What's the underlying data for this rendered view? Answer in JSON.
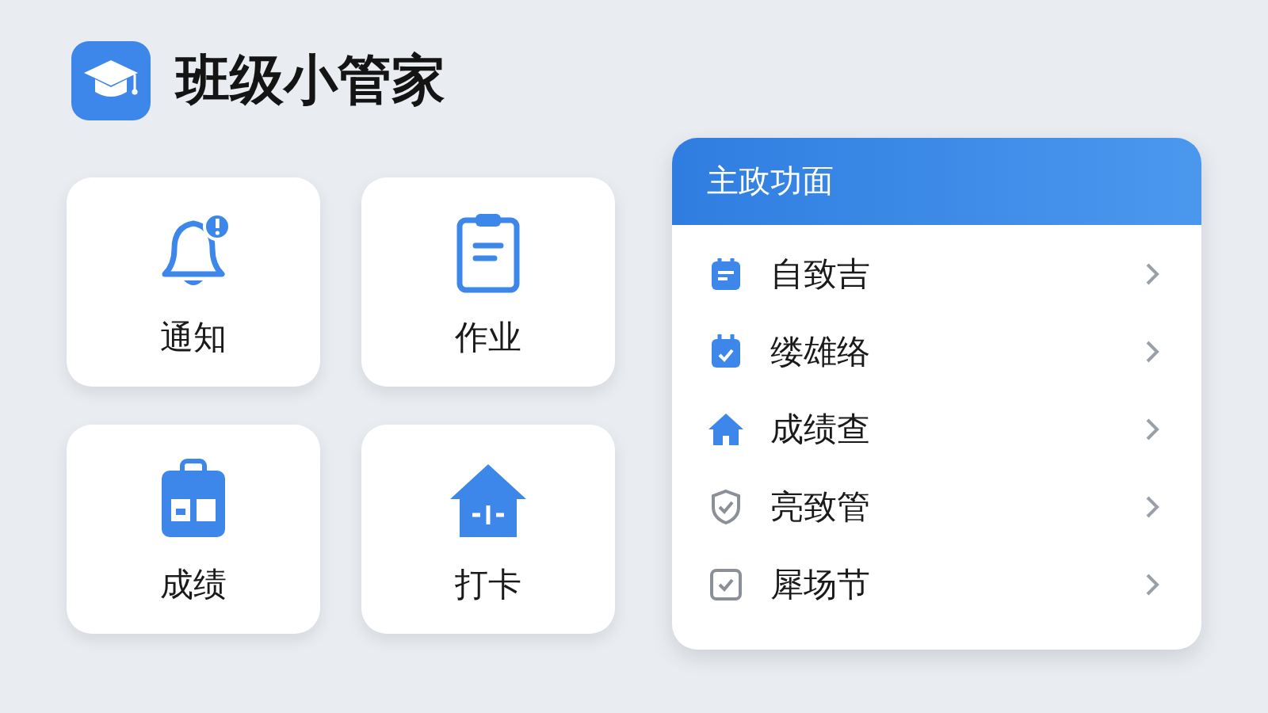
{
  "app": {
    "title": "班级小管家"
  },
  "tiles": [
    {
      "label": "通知",
      "kind": "bell"
    },
    {
      "label": "作业",
      "kind": "clipboard"
    },
    {
      "label": "成绩",
      "kind": "grades"
    },
    {
      "label": "打卡",
      "kind": "house"
    }
  ],
  "panel": {
    "title": "主政功面",
    "items": [
      {
        "label": "自致吉",
        "kind": "notepad"
      },
      {
        "label": "缕雄络",
        "kind": "calendar"
      },
      {
        "label": "成绩查",
        "kind": "home"
      },
      {
        "label": "亮致管",
        "kind": "shield"
      },
      {
        "label": "犀场节",
        "kind": "checkbox"
      }
    ]
  }
}
